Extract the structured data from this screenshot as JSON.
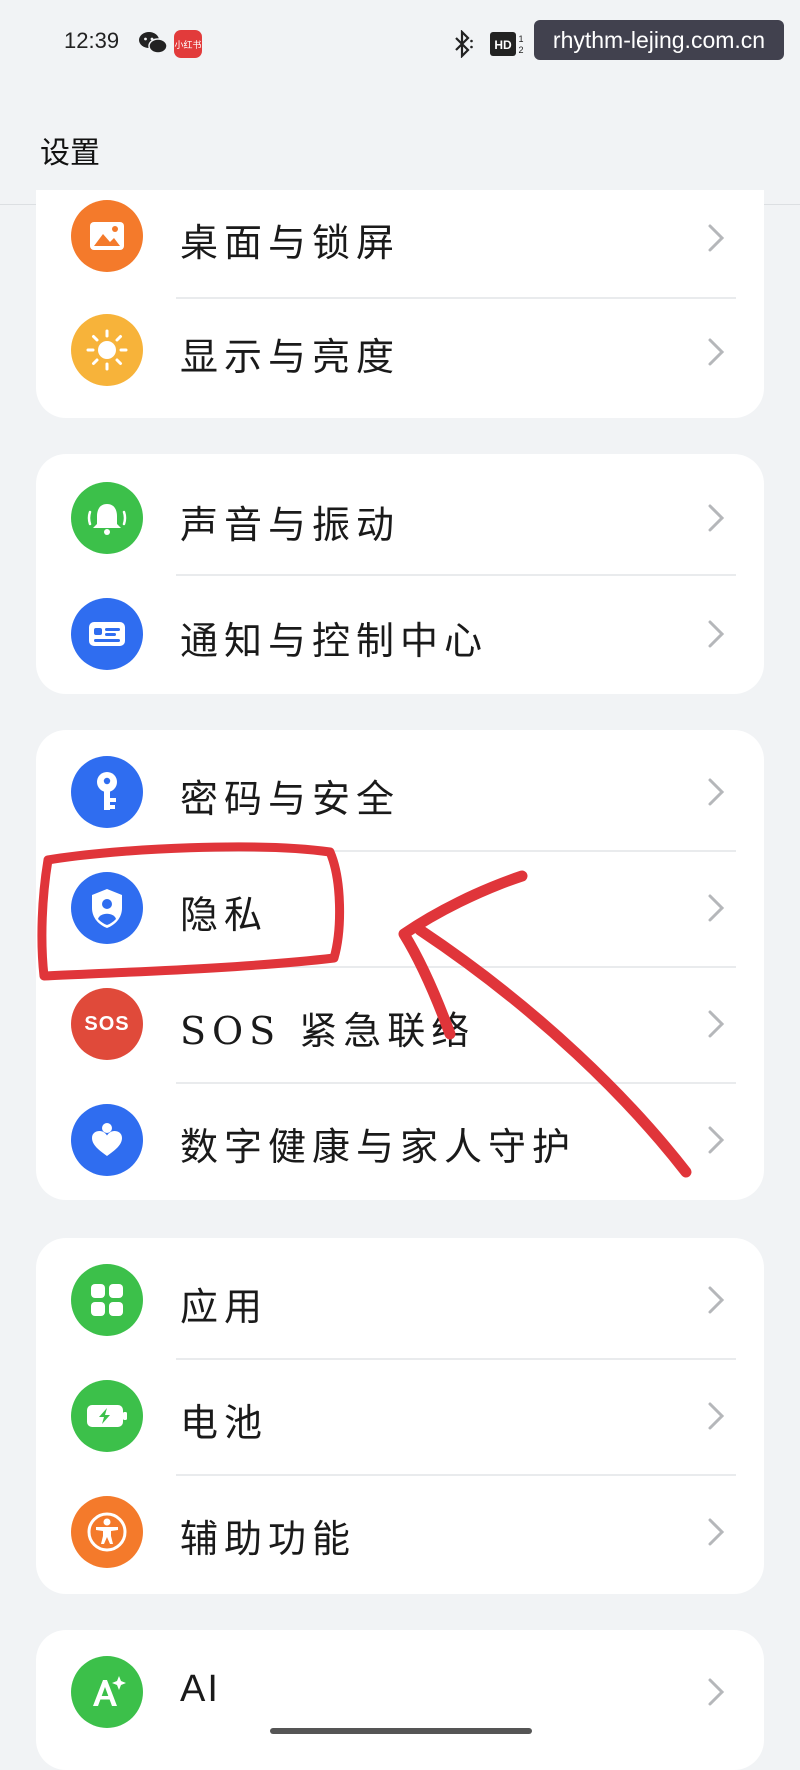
{
  "status_bar": {
    "time": "12:39",
    "redbook_label": "小红书",
    "hd_label": "HD",
    "icons": [
      "wechat-icon",
      "redbook-icon",
      "bluetooth-icon",
      "hd-icon"
    ]
  },
  "watermark": "rhythm-lejing.com.cn",
  "header": {
    "title": "设置"
  },
  "groups": [
    {
      "items": [
        {
          "label": "桌面与锁屏",
          "icon": "wallpaper-icon",
          "color": "#f47a2b"
        },
        {
          "label": "显示与亮度",
          "icon": "brightness-icon",
          "color": "#f7b33a"
        }
      ]
    },
    {
      "items": [
        {
          "label": "声音与振动",
          "icon": "bell-icon",
          "color": "#3cc04a"
        },
        {
          "label": "通知与控制中心",
          "icon": "notification-icon",
          "color": "#2f6df0"
        }
      ]
    },
    {
      "items": [
        {
          "label": "密码与安全",
          "icon": "key-icon",
          "color": "#2f6df0"
        },
        {
          "label": "隐私",
          "icon": "privacy-shield-icon",
          "color": "#2f6df0"
        },
        {
          "label": "SOS 紧急联络",
          "icon": "sos-icon",
          "icon_text": "SOS",
          "color": "#e04a3a"
        },
        {
          "label": "数字健康与家人守护",
          "icon": "heart-icon",
          "color": "#2f6df0"
        }
      ]
    },
    {
      "items": [
        {
          "label": "应用",
          "icon": "apps-icon",
          "color": "#3cc04a"
        },
        {
          "label": "电池",
          "icon": "battery-icon",
          "color": "#3cc04a"
        },
        {
          "label": "辅助功能",
          "icon": "accessibility-icon",
          "color": "#f47a2b"
        }
      ]
    },
    {
      "items": [
        {
          "label": "AI",
          "icon": "ai-icon",
          "color": "#3cc04a"
        }
      ]
    }
  ],
  "annotation": {
    "color": "#e0353a"
  }
}
